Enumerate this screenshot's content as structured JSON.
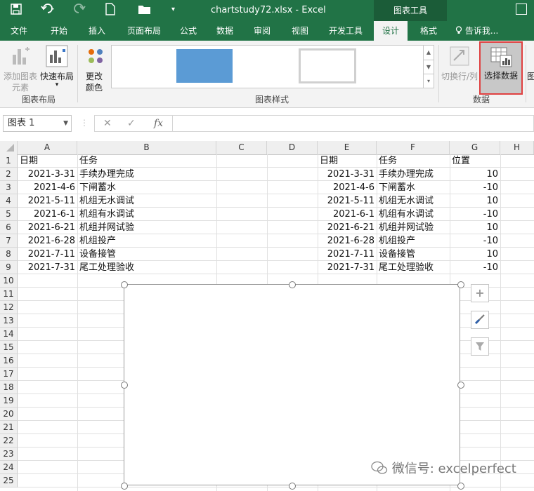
{
  "titlebar": {
    "title": "chartstudy72.xlsx - Excel",
    "context_tab": "图表工具",
    "icons": [
      "save-icon",
      "undo-icon",
      "redo-icon",
      "new-file-icon",
      "open-file-icon",
      "customize-qat-icon",
      "ribbon-display-icon"
    ]
  },
  "tabs": [
    "文件",
    "开始",
    "插入",
    "页面布局",
    "公式",
    "数据",
    "审阅",
    "视图",
    "开发工具",
    "设计",
    "格式"
  ],
  "active_tab": "设计",
  "tell_me": "告诉我...",
  "ribbon": {
    "add_element_line1": "添加图表",
    "add_element_line2": "元素",
    "quick_layout": "快速布局",
    "change_color_line1": "更改",
    "change_color_line2": "颜色",
    "group_layout": "图表布局",
    "group_styles": "图表样式",
    "switch_row_col": "切换行/列",
    "select_data": "选择数据",
    "group_data": "数据",
    "cut_off": "图"
  },
  "formula_bar": {
    "name_box": "图表 1",
    "cancel": "✕",
    "enter": "✓",
    "fx": "fx",
    "formula": ""
  },
  "grid": {
    "columns": [
      "A",
      "B",
      "C",
      "D",
      "E",
      "F",
      "G",
      "H"
    ],
    "rows": [
      "1",
      "2",
      "3",
      "4",
      "5",
      "6",
      "7",
      "8",
      "9",
      "10",
      "11",
      "12",
      "13",
      "14",
      "15",
      "16",
      "17",
      "18",
      "19",
      "20",
      "21",
      "22",
      "23",
      "24",
      "25"
    ],
    "table1": {
      "header_date": "日期",
      "header_task": "任务",
      "dates": [
        "2021-3-31",
        "2021-4-6",
        "2021-5-11",
        "2021-6-1",
        "2021-6-21",
        "2021-6-28",
        "2021-7-11",
        "2021-7-31"
      ],
      "tasks": [
        "手续办理完成",
        "下闸蓄水",
        "机组无水调试",
        "机组有水调试",
        "机组并网试验",
        "机组投产",
        "设备接管",
        "尾工处理验收"
      ]
    },
    "table2": {
      "header_date": "日期",
      "header_task": "任务",
      "header_pos": "位置",
      "dates": [
        "2021-3-31",
        "2021-4-6",
        "2021-5-11",
        "2021-6-1",
        "2021-6-21",
        "2021-6-28",
        "2021-7-11",
        "2021-7-31"
      ],
      "tasks": [
        "手续办理完成",
        "下闸蓄水",
        "机组无水调试",
        "机组有水调试",
        "机组并网试验",
        "机组投产",
        "设备接管",
        "尾工处理验收"
      ],
      "positions": [
        "10",
        "-10",
        "10",
        "-10",
        "10",
        "-10",
        "10",
        "-10"
      ]
    }
  },
  "chart_buttons": {
    "add": "+",
    "icons": [
      "plus-icon",
      "brush-icon",
      "filter-icon"
    ]
  },
  "watermark": "微信号: excelperfect"
}
